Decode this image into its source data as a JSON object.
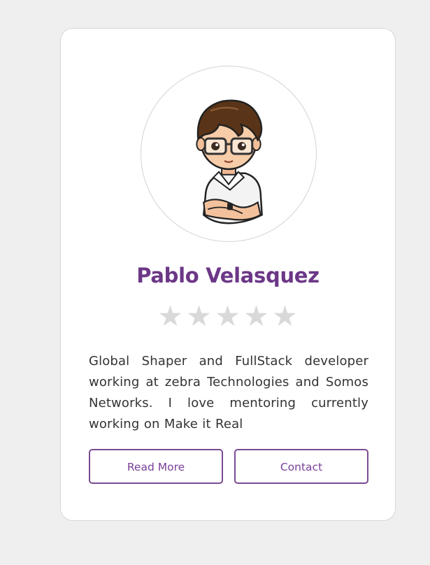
{
  "profile": {
    "name": "Pablo Velasquez",
    "rating": 0,
    "rating_max": 5,
    "star_char": "★",
    "bio": "Global Shaper and FullStack developer working at zebra Technologies and Somos Networks. I love mentoring currently working on Make it Real",
    "avatar_icon": "cartoon-avatar-glasses"
  },
  "actions": {
    "read_more_label": "Read More",
    "contact_label": "Contact"
  },
  "colors": {
    "background": "#efefef",
    "card": "#ffffff",
    "accent": "#6c3787",
    "star_empty": "#d9d9d9",
    "text": "#333333"
  }
}
